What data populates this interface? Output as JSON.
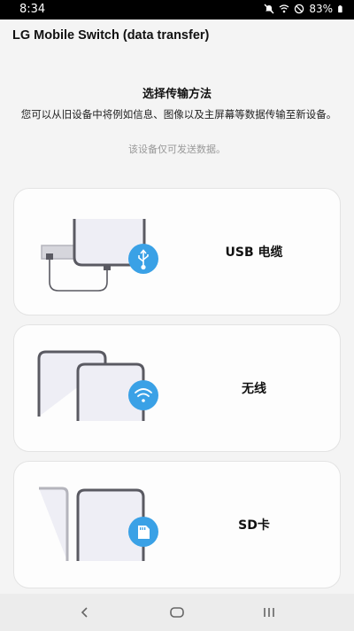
{
  "status_bar": {
    "time": "8:34",
    "battery": "83%",
    "icons": [
      "mute-icon",
      "wifi-icon",
      "do-not-disturb-icon",
      "battery-icon"
    ]
  },
  "app_bar": {
    "title": "LG Mobile Switch (data transfer)"
  },
  "intro": {
    "heading": "选择传输方法",
    "description": "您可以从旧设备中将例如信息、图像以及主屏幕等数据传输至新设备。",
    "note": "该设备仅可发送数据。"
  },
  "options": [
    {
      "label": "USB 电缆",
      "icon": "usb-icon"
    },
    {
      "label": "无线",
      "icon": "wifi-icon"
    },
    {
      "label": "SD卡",
      "icon": "sd-card-icon"
    }
  ],
  "nav_bar": {
    "icons": [
      "back-icon",
      "home-icon",
      "recents-icon"
    ]
  },
  "colors": {
    "accent": "#3aa1e6",
    "device_outline": "#5a5a62",
    "device_fill": "#eeeef5",
    "background": "#f4f4f4",
    "card": "#fdfdfd"
  }
}
